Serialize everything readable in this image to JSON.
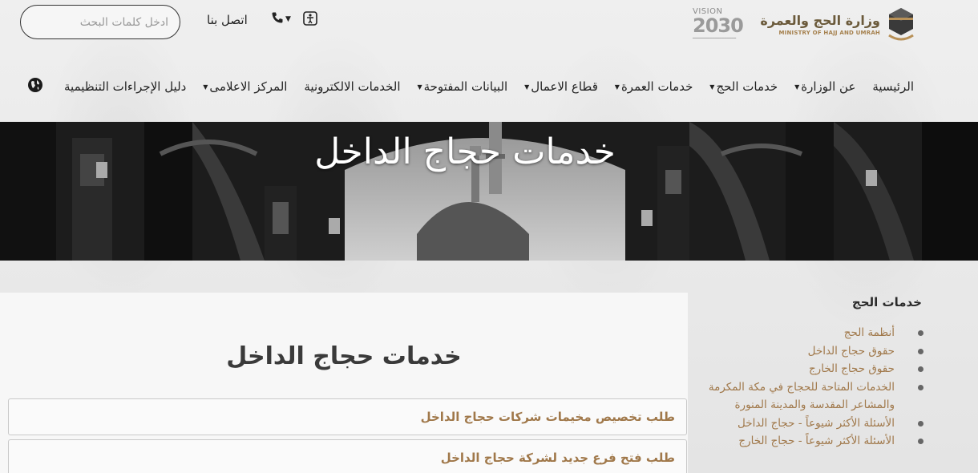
{
  "header": {
    "search_placeholder": "ادخل كلمات البحث",
    "contact_label": "اتصل بنا",
    "logo": {
      "vision_top": "VISION",
      "vision_year": "2030",
      "ministry_ar": "وزارة الحج والعمرة",
      "ministry_en": "MINISTRY OF HAJJ AND UMRAH"
    },
    "icons": {
      "phone": "phone-icon",
      "accessibility": "accessibility-icon",
      "globe": "globe-icon"
    }
  },
  "nav": {
    "items": [
      {
        "label": "الرئيسية",
        "dropdown": false
      },
      {
        "label": "عن الوزارة",
        "dropdown": true
      },
      {
        "label": "خدمات الحج",
        "dropdown": true
      },
      {
        "label": "خدمات العمرة",
        "dropdown": true
      },
      {
        "label": "قطاع الاعمال",
        "dropdown": true
      },
      {
        "label": "البيانات المفتوحة",
        "dropdown": true
      },
      {
        "label": "الخدمات الالكترونية",
        "dropdown": false
      },
      {
        "label": "المركز الاعلامى",
        "dropdown": true
      },
      {
        "label": "دليل الإجراءات التنظيمية",
        "dropdown": false
      }
    ]
  },
  "hero": {
    "title": "خدمات حجاج الداخل"
  },
  "main": {
    "title": "خدمات حجاج الداخل",
    "services": [
      "طلب تخصيص مخيمات شركات حجاج الداخل",
      "طلب فتح فرع جديد لشركة حجاج الداخل"
    ]
  },
  "sidebar": {
    "title": "خدمات الحج",
    "items": [
      "أنظمة الحج",
      "حقوق حجاج الداخل",
      "حقوق حجاج الخارج",
      "الخدمات المتاحة للحجاج في مكة المكرمة والمشاعر المقدسة والمدينة المنورة",
      "الأسئلة الأكثر شيوعاً - حجاج الداخل",
      "الأسئلة الأكثر شيوعاً - حجاج الخارج"
    ]
  },
  "colors": {
    "accent": "#a0784a",
    "text": "#222222",
    "hero_bg": "#1f1f1f"
  }
}
